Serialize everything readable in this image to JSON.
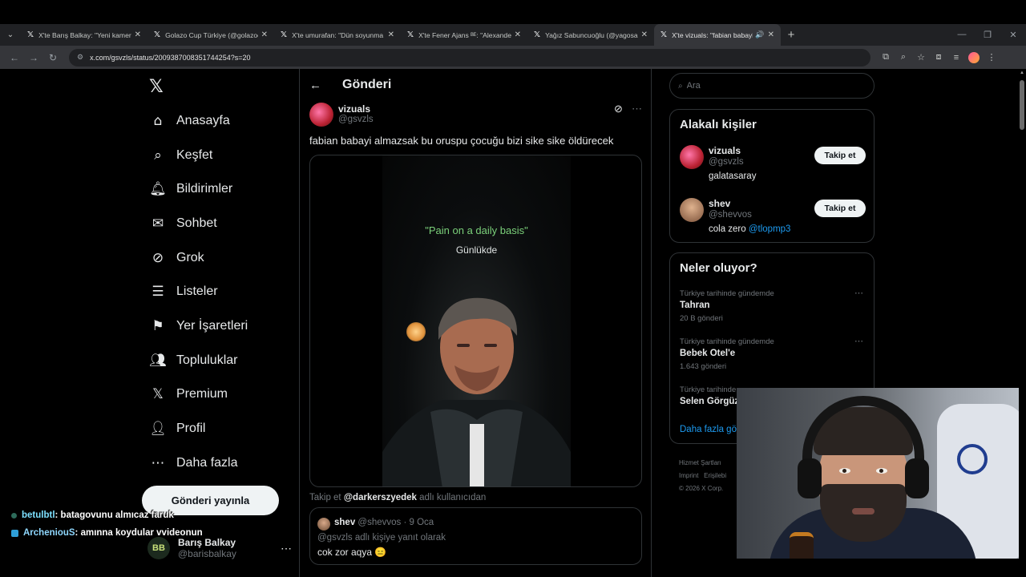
{
  "browser": {
    "tabs": [
      {
        "title": "X'te Barış Balkay: \"Yeni kamera",
        "active": false
      },
      {
        "title": "Golazo Cup Türkiye (@golazoc",
        "active": false
      },
      {
        "title": "X'te umurafan: \"Dün soyunma",
        "active": false
      },
      {
        "title": "X'te Fener Ajans ᴮᴱ: \"Alexander",
        "active": false
      },
      {
        "title": "Yağız Sabuncuoğlu (@yagosab",
        "active": false
      },
      {
        "title": "X'te vizuals: \"fabian babayi",
        "active": true
      }
    ],
    "url": "x.com/gsvzls/status/2009387008351744254?s=20"
  },
  "nav": {
    "items": [
      {
        "label": "Anasayfa",
        "icon": "home-icon"
      },
      {
        "label": "Keşfet",
        "icon": "search-icon"
      },
      {
        "label": "Bildirimler",
        "icon": "bell-icon"
      },
      {
        "label": "Sohbet",
        "icon": "mail-icon"
      },
      {
        "label": "Grok",
        "icon": "grok-icon"
      },
      {
        "label": "Listeler",
        "icon": "list-icon"
      },
      {
        "label": "Yer İşaretleri",
        "icon": "bookmark-icon"
      },
      {
        "label": "Topluluklar",
        "icon": "people-icon"
      },
      {
        "label": "Premium",
        "icon": "x-icon"
      },
      {
        "label": "Profil",
        "icon": "person-icon"
      },
      {
        "label": "Daha fazla",
        "icon": "more-circle-icon"
      }
    ],
    "post_button": "Gönderi yayınla",
    "account": {
      "name": "Barış Balkay",
      "handle": "@barisbalkay",
      "avatar_text": "BB"
    }
  },
  "main": {
    "header": "Gönderi",
    "post": {
      "author": "vizuals",
      "handle": "@gsvzls",
      "text": "fabian babayi almazsak bu oruspu çocuğu bizi sike sike öldürecek",
      "media_quote": "\"Pain on a daily basis\"",
      "media_sub": "Günlükde"
    },
    "follow_prompt": {
      "prefix": "Takip et ",
      "user": "@darkerszyedek",
      "suffix": " adlı kullanıcıdan"
    },
    "reply": {
      "author": "shev",
      "handle": "@shevvos",
      "date": "· 9 Oca",
      "reply_to": "@gsvzls adlı kişiye yanıt olarak",
      "text": "cok zor aqya 😑"
    }
  },
  "right": {
    "search_placeholder": "Ara",
    "people_title": "Alakalı kişiler",
    "people": [
      {
        "name": "vizuals",
        "handle": "@gsvzls",
        "bio": "galatasaray",
        "bio_link": "",
        "button": "Takip et"
      },
      {
        "name": "shev",
        "handle": "@shevvos",
        "bio": "cola zero ",
        "bio_link": "@tlopmp3",
        "button": "Takip et"
      }
    ],
    "trends_title": "Neler oluyor?",
    "trends": [
      {
        "context": "Türkiye tarihinde gündemde",
        "title": "Tahran",
        "count": "20 B gönderi"
      },
      {
        "context": "Türkiye tarihinde gündemde",
        "title": "Bebek Otel'e",
        "count": "1.643 gönderi"
      },
      {
        "context": "Türkiye tarihinde",
        "title": "Selen Görgüz",
        "count": ""
      }
    ],
    "show_more": "Daha fazla gös",
    "footer": [
      "Hizmet Şartları",
      "Imprint",
      "Erişilebi",
      "© 2026 X Corp."
    ]
  },
  "chat": [
    {
      "user": "betulbtl",
      "message": " : batagovunu almıcaz faruk"
    },
    {
      "user": "ArcheniouS",
      "message": " : amınna koydular vvideonun"
    }
  ]
}
